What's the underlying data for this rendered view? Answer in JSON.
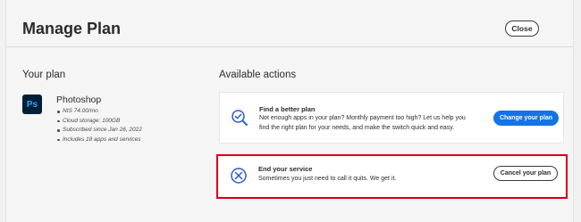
{
  "header": {
    "title": "Manage Plan",
    "close_label": "Close"
  },
  "your_plan": {
    "section_title": "Your plan",
    "product_icon_text": "Ps",
    "product_name": "Photoshop",
    "details": [
      "NIS 74.00/mo",
      "Cloud storage: 100GB",
      "Subscribed since Jan 26, 2022",
      "Includes 18 apps and services"
    ]
  },
  "actions": {
    "section_title": "Available actions",
    "find_plan": {
      "icon": "search-check-icon",
      "title": "Find a better plan",
      "description": "Not enough apps in your plan? Monthly payment too high? Let us help you find the right plan for your needs, and make the switch quick and easy.",
      "button_label": "Change your plan"
    },
    "end_service": {
      "icon": "cancel-circle-icon",
      "title": "End your service",
      "description": "Sometimes you just need to call it quits. We get it.",
      "button_label": "Cancel your plan"
    }
  },
  "colors": {
    "primary_button": "#1473e6",
    "highlight_outline": "#d9001b",
    "photoshop_bg": "#001e36",
    "photoshop_fg": "#31a8ff"
  }
}
